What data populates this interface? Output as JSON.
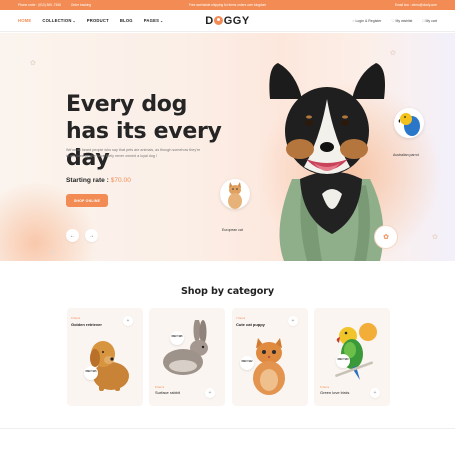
{
  "topbar": {
    "phone": "Phone order : (010) 365 -7545",
    "order_tracking": "Order tracking",
    "promo": "Free worldwide shipping for items orders over kingdom",
    "email": "Email box : demo@doxly.com"
  },
  "nav": {
    "items": [
      {
        "label": "HOME",
        "active": true
      },
      {
        "label": "COLLECTION",
        "dropdown": true
      },
      {
        "label": "PRODUCT"
      },
      {
        "label": "BLOG"
      },
      {
        "label": "PAGES",
        "dropdown": true
      }
    ],
    "logo": {
      "pre": "D",
      "post": "GGY"
    },
    "login": "Login & Register",
    "wishlist": "My wishlist",
    "cart": "My cart"
  },
  "hero": {
    "title": "Every dog has its every day",
    "description": "We've all heard people who say that pets are animals, as though somehow they're in our lives people have likely never owned a loyal dog !",
    "rate_label": "Starting rate :",
    "rate_value": "$70.00",
    "cta": "SHOP ONLINE",
    "prev_icon": "arrow-left-icon",
    "next_icon": "arrow-right-icon",
    "cat_label": "European cat",
    "parrot_label": "Australian parrot"
  },
  "categories": {
    "title": "Shop by category",
    "items": [
      {
        "tag": "9 Items",
        "name": "Golden retriever",
        "price": "ONLY $15",
        "position": "top"
      },
      {
        "tag": "",
        "name": "",
        "price": "ONLY $25",
        "tag_bottom": "8 Items",
        "name_bottom": "Surface rabbit",
        "position": "bottom"
      },
      {
        "tag": "7 Items",
        "name": "Cute cat puppy",
        "price": "ONLY $12",
        "position": "top"
      },
      {
        "tag": "",
        "name": "",
        "price": "ONLY $40",
        "tag_bottom": "6 Items",
        "name_bottom": "Green love birds",
        "position": "bottom"
      }
    ]
  },
  "colors": {
    "accent": "#f28c54"
  }
}
